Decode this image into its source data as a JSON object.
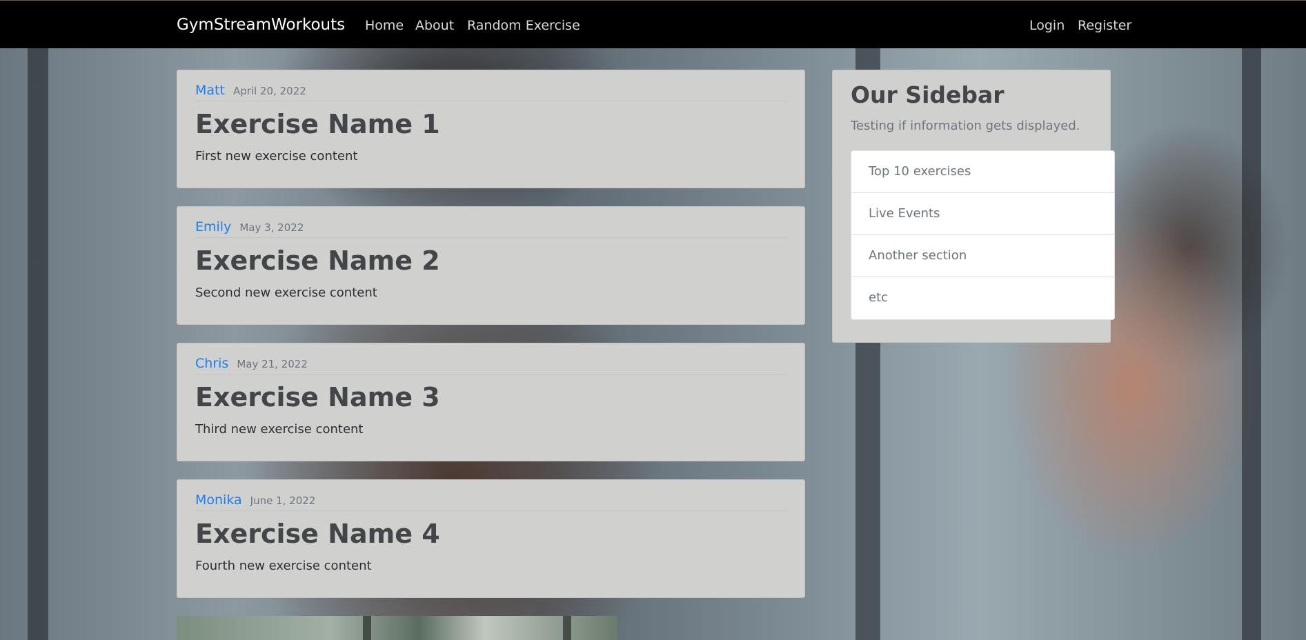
{
  "navbar": {
    "brand": "GymStreamWorkouts",
    "links": [
      "Home",
      "About",
      "Random Exercise"
    ],
    "auth_links": [
      "Login",
      "Register"
    ]
  },
  "posts": [
    {
      "author": "Matt",
      "date": "April 20, 2022",
      "title": "Exercise Name 1",
      "content": "First new exercise content"
    },
    {
      "author": "Emily",
      "date": "May 3, 2022",
      "title": "Exercise Name 2",
      "content": "Second new exercise content"
    },
    {
      "author": "Chris",
      "date": "May 21, 2022",
      "title": "Exercise Name 3",
      "content": "Third new exercise content"
    },
    {
      "author": "Monika",
      "date": "June 1, 2022",
      "title": "Exercise Name 4",
      "content": "Fourth new exercise content"
    }
  ],
  "sidebar": {
    "title": "Our Sidebar",
    "subtitle": "Testing if information gets displayed.",
    "items": [
      "Top 10 exercises",
      "Live Events",
      "Another section",
      "etc"
    ]
  },
  "colors": {
    "navbar_bg": "#000000",
    "card_bg": "#d0d0ce",
    "link_blue": "#1d7df2"
  }
}
